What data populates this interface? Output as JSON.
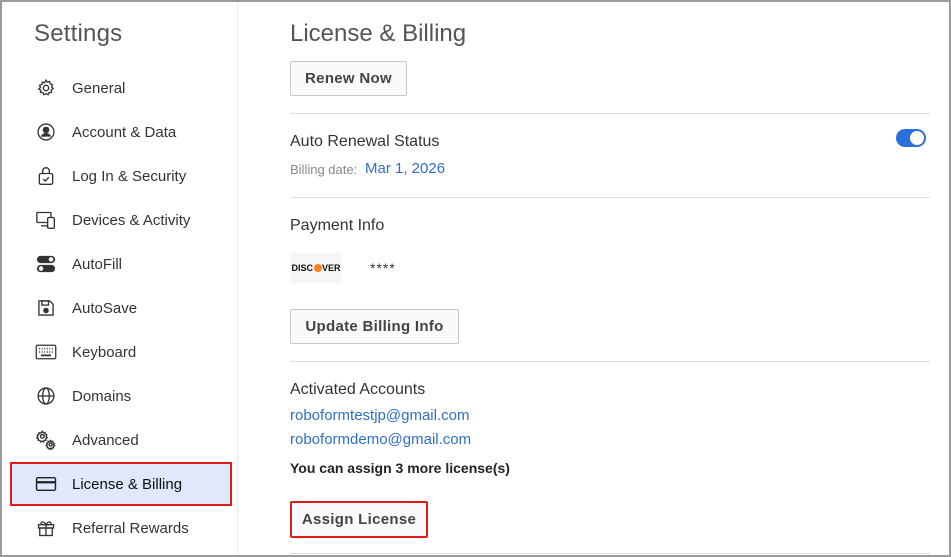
{
  "sidebar": {
    "title": "Settings",
    "items": [
      {
        "label": "General",
        "icon": "gear-icon"
      },
      {
        "label": "Account & Data",
        "icon": "account-circle-icon"
      },
      {
        "label": "Log In & Security",
        "icon": "lock-icon"
      },
      {
        "label": "Devices & Activity",
        "icon": "devices-icon"
      },
      {
        "label": "AutoFill",
        "icon": "toggles-icon"
      },
      {
        "label": "AutoSave",
        "icon": "save-icon"
      },
      {
        "label": "Keyboard",
        "icon": "keyboard-icon"
      },
      {
        "label": "Domains",
        "icon": "globe-icon"
      },
      {
        "label": "Advanced",
        "icon": "advanced-gears-icon"
      },
      {
        "label": "License & Billing",
        "icon": "credit-card-icon",
        "active": true
      },
      {
        "label": "Referral Rewards",
        "icon": "gift-icon"
      }
    ]
  },
  "main": {
    "title": "License & Billing",
    "renew_button": "Renew Now",
    "auto_renewal": {
      "label": "Auto Renewal Status",
      "enabled": true,
      "billing_date_label": "Billing date:",
      "billing_date_value": "Mar 1, 2026"
    },
    "payment": {
      "label": "Payment Info",
      "card_brand": "DISCOVER",
      "card_masked": "****",
      "update_button": "Update Billing Info"
    },
    "activated": {
      "label": "Activated Accounts",
      "accounts": [
        "roboformtestjp@gmail.com",
        "roboformdemo@gmail.com"
      ],
      "note": "You can assign 3 more license(s)",
      "assign_button": "Assign License"
    }
  },
  "colors": {
    "accent": "#2a6fdb",
    "link": "#2f6fc9",
    "active_bg": "#dfe9fb",
    "highlight_border": "#e01b1b"
  }
}
